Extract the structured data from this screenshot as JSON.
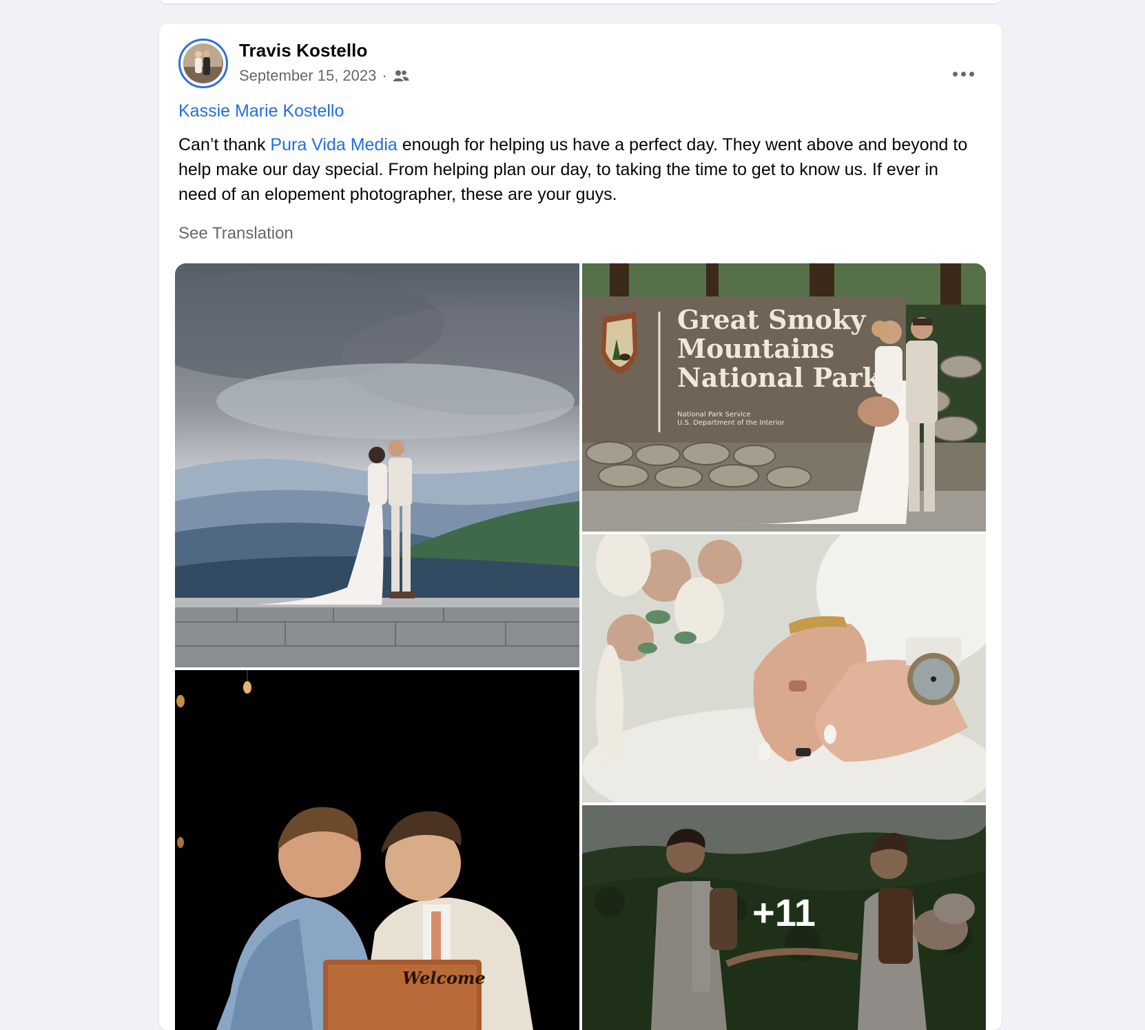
{
  "post": {
    "author": "Travis Kostello",
    "date": "September 15, 2023",
    "separator": "·",
    "audience_icon": "friends-icon",
    "more_icon": "more-options-icon",
    "tagged_person": "Kassie Marie Kostello",
    "body_pre": "Can’t thank ",
    "body_link": "Pura Vida Media",
    "body_post": " enough for helping us have a perfect day. They went above and beyond to help make our day special. From helping plan our day, to taking the time to get to know us. If ever in need of an elopement photographer, these are your guys.",
    "see_translation": "See Translation"
  },
  "photos": {
    "sign_line1": "Great Smoky",
    "sign_line2": "Mountains",
    "sign_line3": "National Park",
    "sign_sub1": "National Park Service",
    "sign_sub2": "U.S. Department of the Interior",
    "welcome_sign": "Welcome",
    "more_count": "+11"
  },
  "colors": {
    "link": "#216fdb",
    "secondary_text": "#65676b",
    "page_background": "#f0f2f5"
  }
}
